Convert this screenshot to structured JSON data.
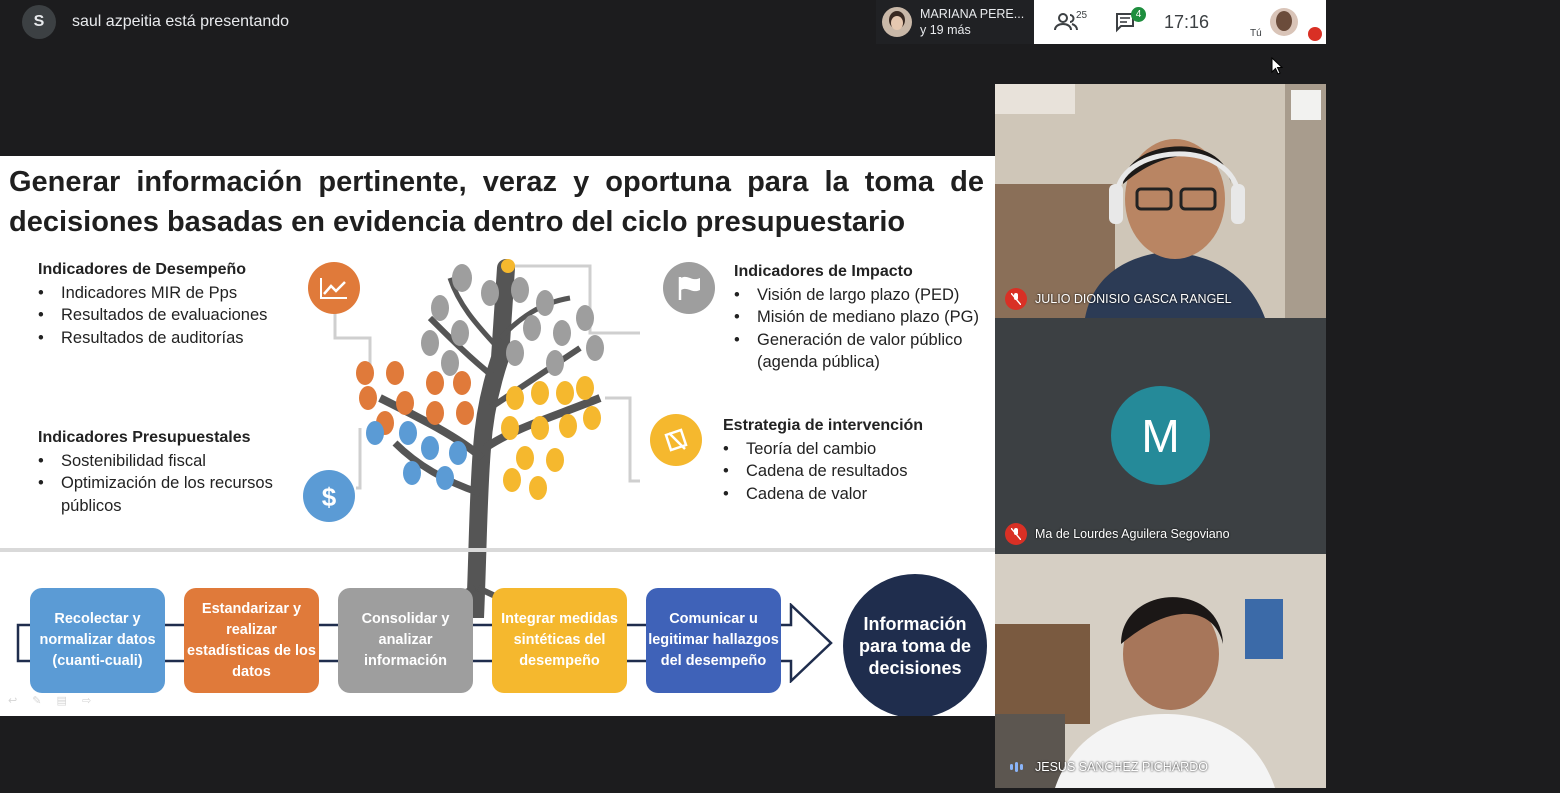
{
  "presenter": {
    "initial": "S",
    "text": "saul azpeitia está presentando"
  },
  "people": {
    "name": "MARIANA PERE...",
    "more": "y 19 más"
  },
  "toolbar": {
    "participants_count": "25",
    "chat_count": "4",
    "time": "17:16",
    "self_label": "Tú"
  },
  "slide": {
    "title": "Generar información pertinente, veraz y oportuna para la toma de decisiones basadas en evidencia dentro del ciclo presupuestario",
    "desempeno": {
      "heading": "Indicadores de Desempeño",
      "items": [
        "Indicadores MIR de Pps",
        "Resultados de evaluaciones",
        "Resultados de auditorías"
      ]
    },
    "presupuestales": {
      "heading": "Indicadores Presupuestales",
      "items": [
        "Sostenibilidad fiscal",
        "Optimización de los recursos públicos"
      ]
    },
    "impacto": {
      "heading": "Indicadores de Impacto",
      "items": [
        "Visión de largo plazo (PED)",
        "Misión de mediano plazo (PG)",
        "Generación de valor público (agenda pública)"
      ]
    },
    "estrategia": {
      "heading": "Estrategia de intervención",
      "items": [
        "Teoría del cambio",
        "Cadena de resultados",
        "Cadena de valor"
      ]
    },
    "process": [
      {
        "label": "Recolectar y normalizar datos (cuanti-cuali)",
        "color": "#5b9bd5"
      },
      {
        "label": "Estandarizar y realizar estadísticas de los datos",
        "color": "#e07a3a"
      },
      {
        "label": "Consolidar y analizar información",
        "color": "#9e9e9e"
      },
      {
        "label": "Integrar medidas sintéticas del desempeño",
        "color": "#f5b82e"
      },
      {
        "label": "Comunicar u legitimar hallazgos del desempeño",
        "color": "#3f62b8"
      }
    ],
    "final": "Información para toma de decisiones",
    "icon_colors": {
      "chart": "#e07a3a",
      "flag": "#9e9e9e",
      "dollar": "#5b9bd5",
      "target": "#f5b82e"
    }
  },
  "tiles": [
    {
      "name": "JULIO DIONISIO GASCA RANGEL"
    },
    {
      "initial": "M",
      "name": "Ma de Lourdes Aguilera Segoviano"
    },
    {
      "name": "JESUS SANCHEZ PICHARDO"
    }
  ]
}
